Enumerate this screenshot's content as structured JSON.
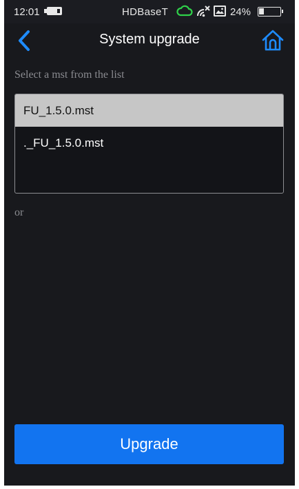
{
  "status_bar": {
    "time": "12:01",
    "network": "HDBaseT",
    "battery_percent": "24%",
    "battery_level": 0.24,
    "icons": [
      "notification-badge-icon",
      "cloud-icon",
      "wifi-off-icon",
      "image-icon",
      "battery-icon"
    ]
  },
  "header": {
    "title": "System upgrade",
    "back_icon": "chevron-left-icon",
    "home_icon": "home-icon"
  },
  "main": {
    "prompt": "Select a mst from the list",
    "files": [
      {
        "name": "FU_1.5.0.mst",
        "selected": true
      },
      {
        "name": "._FU_1.5.0.mst",
        "selected": false
      }
    ],
    "or_label": "or"
  },
  "footer": {
    "upgrade_label": "Upgrade"
  },
  "colors": {
    "background": "#18191d",
    "accent": "#1274f0",
    "selected_row": "#c6c6c6",
    "cloud_icon": "#2fd24a"
  }
}
